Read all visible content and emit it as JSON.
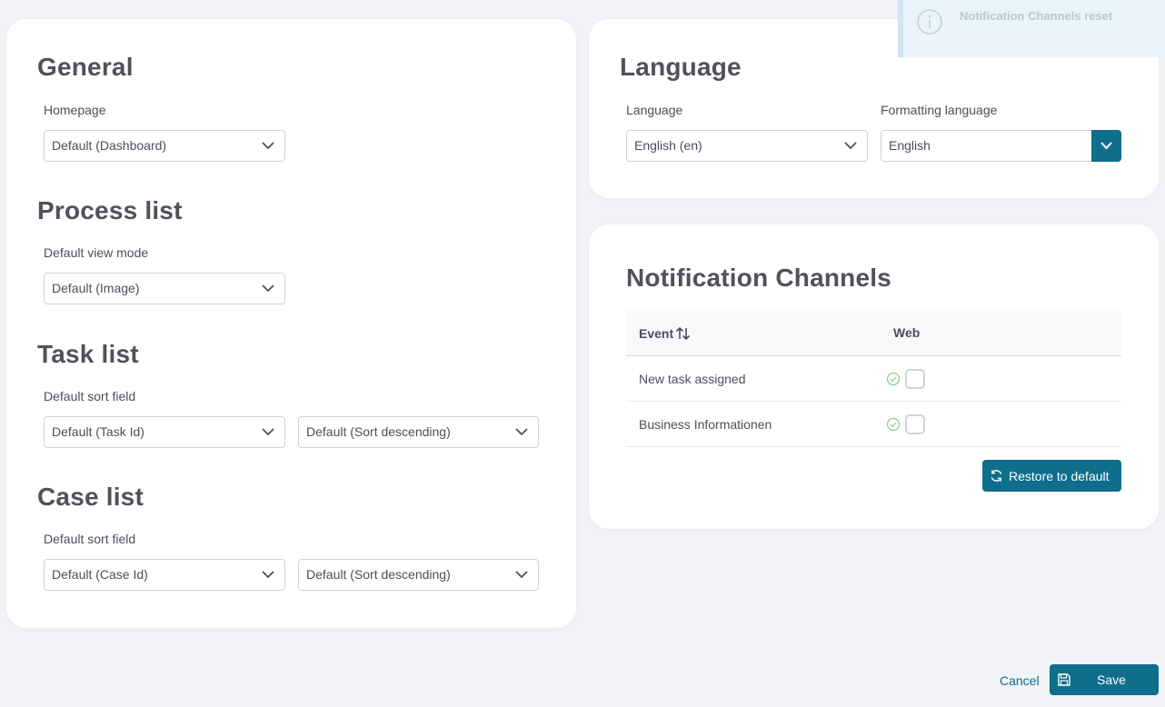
{
  "general": {
    "title": "General",
    "homepage_label": "Homepage",
    "homepage_value": "Default (Dashboard)"
  },
  "process_list": {
    "title": "Process list",
    "view_mode_label": "Default view mode",
    "view_mode_value": "Default (Image)"
  },
  "task_list": {
    "title": "Task list",
    "sort_field_label": "Default sort field",
    "sort_field_value": "Default (Task Id)",
    "sort_dir_value": "Default (Sort descending)"
  },
  "case_list": {
    "title": "Case list",
    "sort_field_label": "Default sort field",
    "sort_field_value": "Default (Case Id)",
    "sort_dir_value": "Default (Sort descending)"
  },
  "language": {
    "title": "Language",
    "language_label": "Language",
    "language_value": "English (en)",
    "formatting_label": "Formatting language",
    "formatting_value": "English"
  },
  "notifications": {
    "title": "Notification Channels",
    "col_event": "Event",
    "col_web": "Web",
    "rows": [
      {
        "event": "New task assigned"
      },
      {
        "event": "Business Informationen"
      }
    ],
    "restore_label": "Restore to default"
  },
  "footer": {
    "cancel_label": "Cancel",
    "save_label": "Save"
  },
  "toast": {
    "message": "Notification Channels reset"
  },
  "colors": {
    "primary": "#0f6e8c",
    "success": "#8fcf8f"
  }
}
